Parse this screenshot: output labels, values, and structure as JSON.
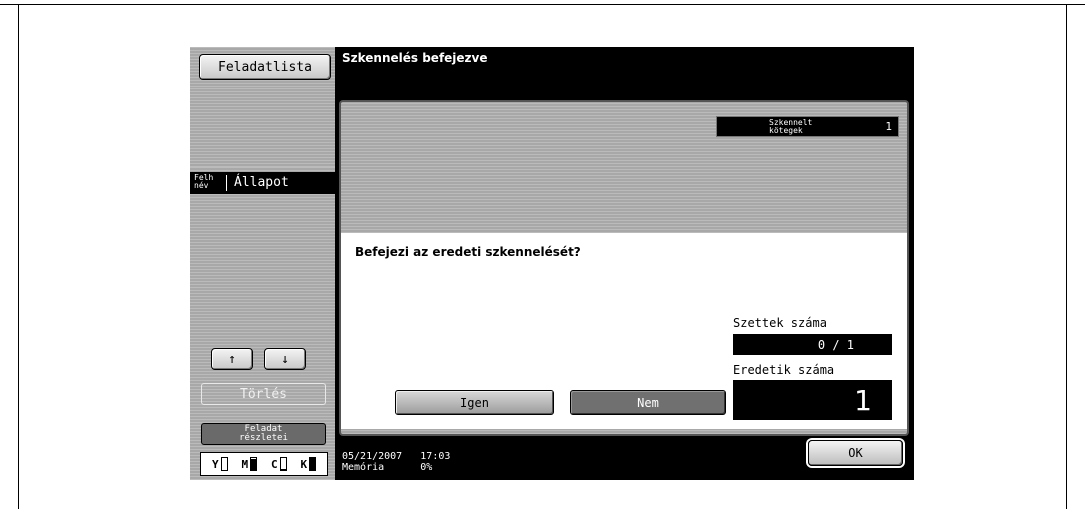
{
  "sidebar": {
    "task_list_label": "Feladatlista",
    "header_user": "Felh név",
    "header_status": "Állapot",
    "up_icon": "↑",
    "down_icon": "↓",
    "delete_label": "Törlés",
    "details_line1": "Feladat",
    "details_line2": "részletei",
    "toner": [
      {
        "label": "Y",
        "level": 0.0
      },
      {
        "label": "M",
        "level": 0.9
      },
      {
        "label": "C",
        "level": 0.05
      },
      {
        "label": "K",
        "level": 1.0
      }
    ]
  },
  "header": {
    "title": "Szkennelés befejezve"
  },
  "counter": {
    "label_line1": "Szkennelt",
    "label_line2": "kötegek",
    "value": "1"
  },
  "dialog": {
    "question": "Befejezi az eredeti szkennelését?",
    "sets_label": "Szettek száma",
    "sets_value": "0 / 1",
    "originals_label": "Eredetik száma",
    "originals_value": "1",
    "yes_label": "Igen",
    "no_label": "Nem"
  },
  "footer": {
    "date": "05/21/2007",
    "time": "17:03",
    "memory_label": "Memória",
    "memory_value": "0%",
    "ok_label": "OK"
  }
}
